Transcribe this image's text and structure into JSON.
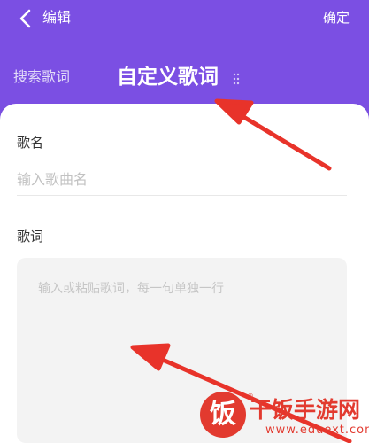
{
  "header": {
    "title": "编辑",
    "confirm_label": "确定",
    "tabs": [
      {
        "label": "搜索歌词",
        "active": false
      },
      {
        "label": "自定义歌词",
        "active": true
      }
    ]
  },
  "form": {
    "song_label": "歌名",
    "song_placeholder": "输入歌曲名",
    "lyrics_label": "歌词",
    "lyrics_placeholder": "输入或粘贴歌词，每一句单独一行"
  },
  "watermark": {
    "seal": "饭",
    "text": "干饭手游网",
    "url": "www.eduext.com",
    "reg": "®"
  },
  "colors": {
    "header_bg": "#7b4fe3",
    "annotation_arrow": "#e8332a"
  },
  "icons": {
    "back": "chevron-left-icon",
    "drag": "drag-handle-icon"
  }
}
